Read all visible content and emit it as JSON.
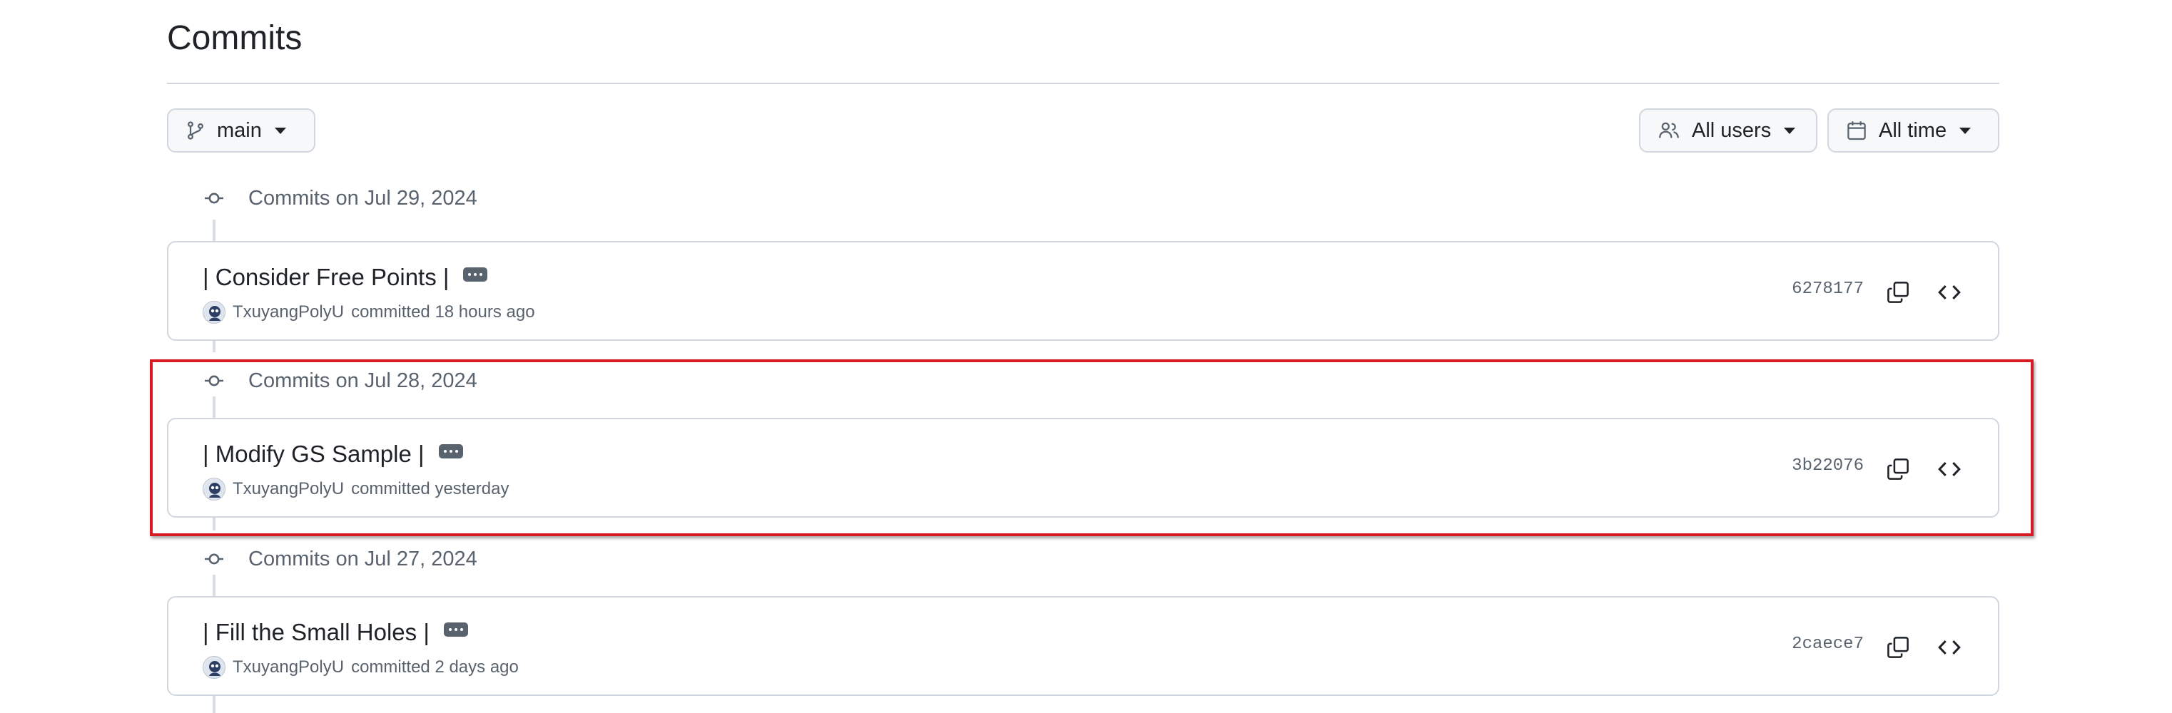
{
  "page": {
    "title": "Commits"
  },
  "toolbar": {
    "branch_label": "main",
    "users_label": "All users",
    "time_label": "All time"
  },
  "groups": [
    {
      "date_label": "Commits on Jul 29, 2024",
      "commits": [
        {
          "title": "| Consider Free Points |",
          "author": "TxuyangPolyU",
          "action": "committed 18 hours ago",
          "sha": "6278177"
        }
      ]
    },
    {
      "date_label": "Commits on Jul 28, 2024",
      "commits": [
        {
          "title": "| Modify GS Sample |",
          "author": "TxuyangPolyU",
          "action": "committed yesterday",
          "sha": "3b22076"
        }
      ]
    },
    {
      "date_label": "Commits on Jul 27, 2024",
      "commits": [
        {
          "title": "| Fill the Small Holes |",
          "author": "TxuyangPolyU",
          "action": "committed 2 days ago",
          "sha": "2caece7"
        }
      ]
    }
  ],
  "icons": {
    "branch": "git-branch-icon",
    "users": "people-icon",
    "time": "calendar-icon",
    "commit": "git-commit-icon",
    "copy": "copy-icon",
    "browse": "code-icon",
    "ellipsis": "ellipsis-icon"
  },
  "colors": {
    "highlight": "#d81b22",
    "border": "#d0d7de",
    "muted_text": "#59636e",
    "text": "#1f2328",
    "button_bg": "#f6f8fa"
  }
}
